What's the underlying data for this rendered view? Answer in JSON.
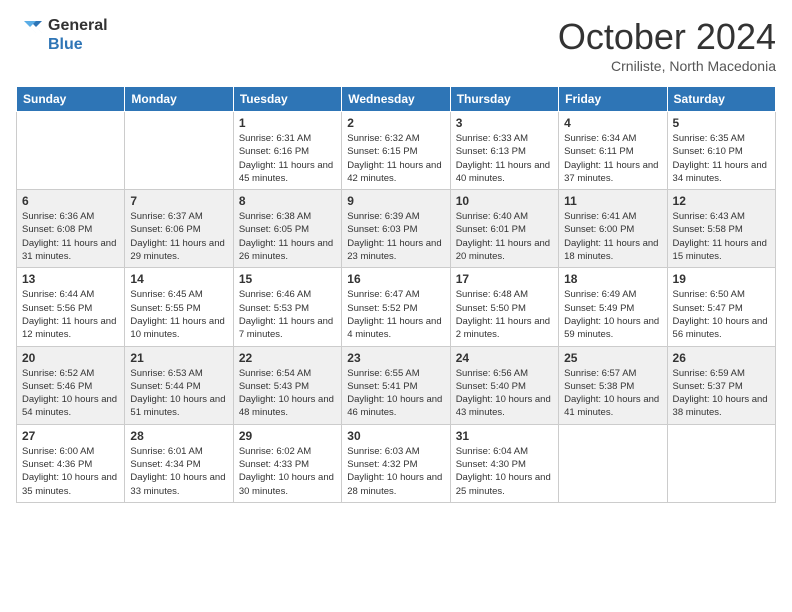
{
  "header": {
    "logo_general": "General",
    "logo_blue": "Blue",
    "month": "October 2024",
    "location": "Crniliste, North Macedonia"
  },
  "days_of_week": [
    "Sunday",
    "Monday",
    "Tuesday",
    "Wednesday",
    "Thursday",
    "Friday",
    "Saturday"
  ],
  "weeks": [
    [
      {
        "day": "",
        "content": ""
      },
      {
        "day": "",
        "content": ""
      },
      {
        "day": "1",
        "content": "Sunrise: 6:31 AM\nSunset: 6:16 PM\nDaylight: 11 hours and 45 minutes."
      },
      {
        "day": "2",
        "content": "Sunrise: 6:32 AM\nSunset: 6:15 PM\nDaylight: 11 hours and 42 minutes."
      },
      {
        "day": "3",
        "content": "Sunrise: 6:33 AM\nSunset: 6:13 PM\nDaylight: 11 hours and 40 minutes."
      },
      {
        "day": "4",
        "content": "Sunrise: 6:34 AM\nSunset: 6:11 PM\nDaylight: 11 hours and 37 minutes."
      },
      {
        "day": "5",
        "content": "Sunrise: 6:35 AM\nSunset: 6:10 PM\nDaylight: 11 hours and 34 minutes."
      }
    ],
    [
      {
        "day": "6",
        "content": "Sunrise: 6:36 AM\nSunset: 6:08 PM\nDaylight: 11 hours and 31 minutes."
      },
      {
        "day": "7",
        "content": "Sunrise: 6:37 AM\nSunset: 6:06 PM\nDaylight: 11 hours and 29 minutes."
      },
      {
        "day": "8",
        "content": "Sunrise: 6:38 AM\nSunset: 6:05 PM\nDaylight: 11 hours and 26 minutes."
      },
      {
        "day": "9",
        "content": "Sunrise: 6:39 AM\nSunset: 6:03 PM\nDaylight: 11 hours and 23 minutes."
      },
      {
        "day": "10",
        "content": "Sunrise: 6:40 AM\nSunset: 6:01 PM\nDaylight: 11 hours and 20 minutes."
      },
      {
        "day": "11",
        "content": "Sunrise: 6:41 AM\nSunset: 6:00 PM\nDaylight: 11 hours and 18 minutes."
      },
      {
        "day": "12",
        "content": "Sunrise: 6:43 AM\nSunset: 5:58 PM\nDaylight: 11 hours and 15 minutes."
      }
    ],
    [
      {
        "day": "13",
        "content": "Sunrise: 6:44 AM\nSunset: 5:56 PM\nDaylight: 11 hours and 12 minutes."
      },
      {
        "day": "14",
        "content": "Sunrise: 6:45 AM\nSunset: 5:55 PM\nDaylight: 11 hours and 10 minutes."
      },
      {
        "day": "15",
        "content": "Sunrise: 6:46 AM\nSunset: 5:53 PM\nDaylight: 11 hours and 7 minutes."
      },
      {
        "day": "16",
        "content": "Sunrise: 6:47 AM\nSunset: 5:52 PM\nDaylight: 11 hours and 4 minutes."
      },
      {
        "day": "17",
        "content": "Sunrise: 6:48 AM\nSunset: 5:50 PM\nDaylight: 11 hours and 2 minutes."
      },
      {
        "day": "18",
        "content": "Sunrise: 6:49 AM\nSunset: 5:49 PM\nDaylight: 10 hours and 59 minutes."
      },
      {
        "day": "19",
        "content": "Sunrise: 6:50 AM\nSunset: 5:47 PM\nDaylight: 10 hours and 56 minutes."
      }
    ],
    [
      {
        "day": "20",
        "content": "Sunrise: 6:52 AM\nSunset: 5:46 PM\nDaylight: 10 hours and 54 minutes."
      },
      {
        "day": "21",
        "content": "Sunrise: 6:53 AM\nSunset: 5:44 PM\nDaylight: 10 hours and 51 minutes."
      },
      {
        "day": "22",
        "content": "Sunrise: 6:54 AM\nSunset: 5:43 PM\nDaylight: 10 hours and 48 minutes."
      },
      {
        "day": "23",
        "content": "Sunrise: 6:55 AM\nSunset: 5:41 PM\nDaylight: 10 hours and 46 minutes."
      },
      {
        "day": "24",
        "content": "Sunrise: 6:56 AM\nSunset: 5:40 PM\nDaylight: 10 hours and 43 minutes."
      },
      {
        "day": "25",
        "content": "Sunrise: 6:57 AM\nSunset: 5:38 PM\nDaylight: 10 hours and 41 minutes."
      },
      {
        "day": "26",
        "content": "Sunrise: 6:59 AM\nSunset: 5:37 PM\nDaylight: 10 hours and 38 minutes."
      }
    ],
    [
      {
        "day": "27",
        "content": "Sunrise: 6:00 AM\nSunset: 4:36 PM\nDaylight: 10 hours and 35 minutes."
      },
      {
        "day": "28",
        "content": "Sunrise: 6:01 AM\nSunset: 4:34 PM\nDaylight: 10 hours and 33 minutes."
      },
      {
        "day": "29",
        "content": "Sunrise: 6:02 AM\nSunset: 4:33 PM\nDaylight: 10 hours and 30 minutes."
      },
      {
        "day": "30",
        "content": "Sunrise: 6:03 AM\nSunset: 4:32 PM\nDaylight: 10 hours and 28 minutes."
      },
      {
        "day": "31",
        "content": "Sunrise: 6:04 AM\nSunset: 4:30 PM\nDaylight: 10 hours and 25 minutes."
      },
      {
        "day": "",
        "content": ""
      },
      {
        "day": "",
        "content": ""
      }
    ]
  ]
}
